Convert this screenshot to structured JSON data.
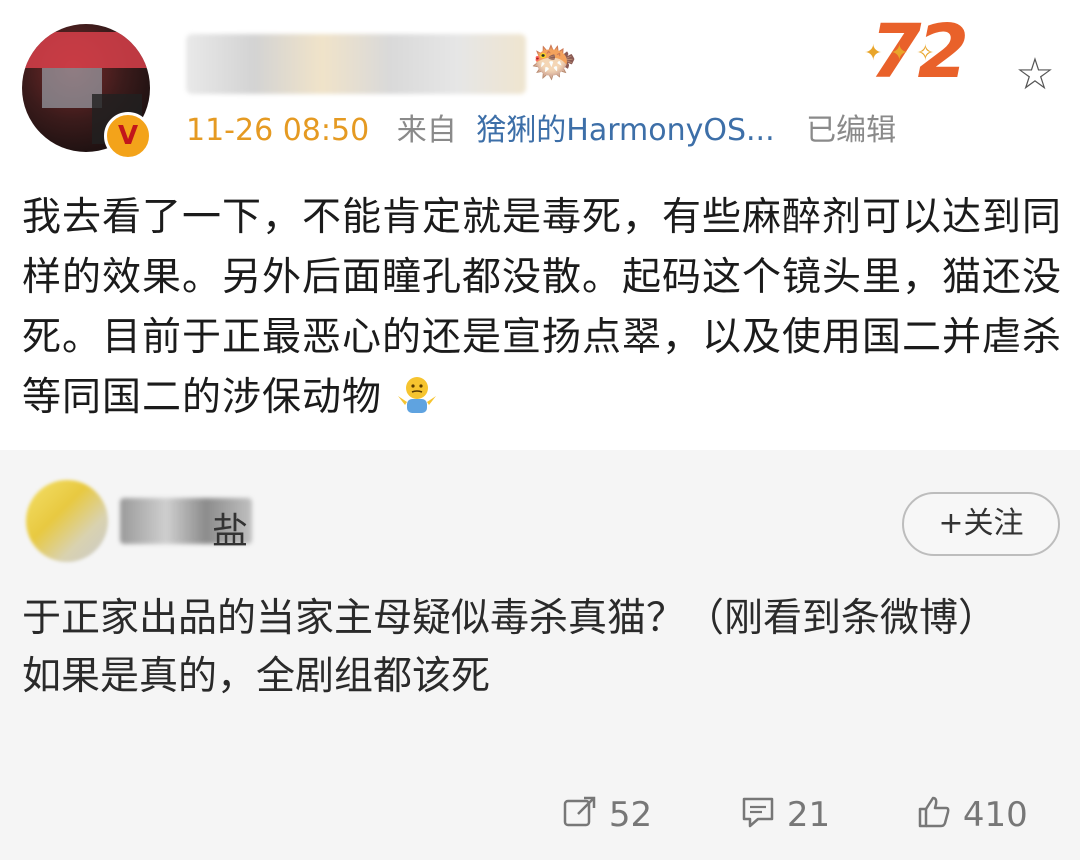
{
  "post": {
    "time": "11-26 08:50",
    "from_label": "来自",
    "source": "猞猁的HarmonyOS...",
    "edited": "已编辑",
    "badge_number": "72",
    "text": "我去看了一下，不能肯定就是毒死，有些麻醉剂可以达到同样的效果。另外后面瞳孔都没散。起码这个镜头里，猫还没死。目前于正最恶心的还是宣扬点翠，以及使用国二并虐杀等同国二的涉保动物"
  },
  "reply": {
    "name_visible_char": "盐",
    "follow_label": "+关注",
    "lines": [
      "于正家出品的当家主母疑似毒杀真猫？（刚看到条微博）",
      "如果是真的，全剧组都该死"
    ],
    "actions": {
      "repost": "52",
      "comment": "21",
      "like": "410"
    }
  },
  "colors": {
    "time": "#e59a22",
    "source_link": "#3d6fa8",
    "badge": "#e9612a"
  }
}
